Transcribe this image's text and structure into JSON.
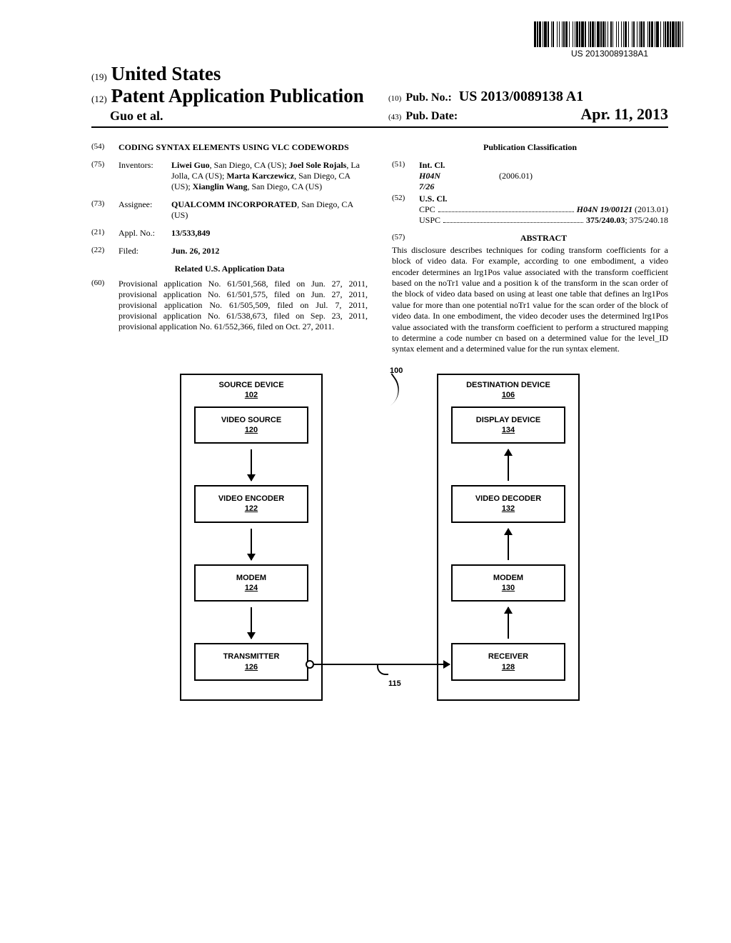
{
  "barcode_number": "US 20130089138A1",
  "header": {
    "tag19": "(19)",
    "us": "United States",
    "tag12": "(12)",
    "pub_title": "Patent Application Publication",
    "authors": "Guo et al.",
    "tag10": "(10)",
    "pub_no_label": "Pub. No.:",
    "pub_no": "US 2013/0089138 A1",
    "tag43": "(43)",
    "pub_date_label": "Pub. Date:",
    "pub_date": "Apr. 11, 2013"
  },
  "left": {
    "f54": {
      "num": "(54)",
      "title": "CODING SYNTAX ELEMENTS USING VLC CODEWORDS"
    },
    "f75": {
      "num": "(75)",
      "label": "Inventors:",
      "body_html": "<b>Liwei Guo</b>, San Diego, CA (US); <b>Joel Sole Rojals</b>, La Jolla, CA (US); <b>Marta Karczewicz</b>, San Diego, CA (US); <b>Xianglin Wang</b>, San Diego, CA (US)"
    },
    "f73": {
      "num": "(73)",
      "label": "Assignee:",
      "body_html": "<b>QUALCOMM INCORPORATED</b>, San Diego, CA (US)"
    },
    "f21": {
      "num": "(21)",
      "label": "Appl. No.:",
      "body_html": "<b>13/533,849</b>"
    },
    "f22": {
      "num": "(22)",
      "label": "Filed:",
      "body_html": "<b>Jun. 26, 2012</b>"
    },
    "related_hdr": "Related U.S. Application Data",
    "f60": {
      "num": "(60)",
      "body": "Provisional application No. 61/501,568, filed on Jun. 27, 2011, provisional application No. 61/501,575, filed on Jun. 27, 2011, provisional application No. 61/505,509, filed on Jul. 7, 2011, provisional application No. 61/538,673, filed on Sep. 23, 2011, provisional application No. 61/552,366, filed on Oct. 27, 2011."
    }
  },
  "right": {
    "class_hdr": "Publication Classification",
    "f51": {
      "num": "(51)",
      "label": "Int. Cl.",
      "line": {
        "code": "H04N 7/26",
        "date": "(2006.01)"
      }
    },
    "f52": {
      "num": "(52)",
      "label": "U.S. Cl.",
      "cpc": {
        "label": "CPC",
        "val_html": "<b><i>H04N 19/00121</i></b> (2013.01)"
      },
      "uspc": {
        "label": "USPC",
        "val_html": "<b>375/240.03</b>; 375/240.18"
      }
    },
    "f57": {
      "num": "(57)",
      "label": "ABSTRACT"
    },
    "abstract": "This disclosure describes techniques for coding transform coefficients for a block of video data. For example, according to one embodiment, a video encoder determines an lrg1Pos value associated with the transform coefficient based on the noTr1 value and a position k of the transform in the scan order of the block of video data based on using at least one table that defines an lrg1Pos value for more than one potential noTr1 value for the scan order of the block of video data. In one embodiment, the video decoder uses the determined lrg1Pos value associated with the transform coefficient to perform a structured mapping to determine a code number cn based on a determined value for the level_ID syntax element and a determined value for the run syntax element."
  },
  "diagram": {
    "ref100": "100",
    "ref115": "115",
    "source": {
      "title": "SOURCE DEVICE",
      "ref": "102",
      "blocks": [
        {
          "name": "VIDEO SOURCE",
          "ref": "120"
        },
        {
          "name": "VIDEO ENCODER",
          "ref": "122"
        },
        {
          "name": "MODEM",
          "ref": "124"
        },
        {
          "name": "TRANSMITTER",
          "ref": "126"
        }
      ]
    },
    "dest": {
      "title": "DESTINATION DEVICE",
      "ref": "106",
      "blocks": [
        {
          "name": "DISPLAY DEVICE",
          "ref": "134"
        },
        {
          "name": "VIDEO DECODER",
          "ref": "132"
        },
        {
          "name": "MODEM",
          "ref": "130"
        },
        {
          "name": "RECEIVER",
          "ref": "128"
        }
      ]
    }
  }
}
